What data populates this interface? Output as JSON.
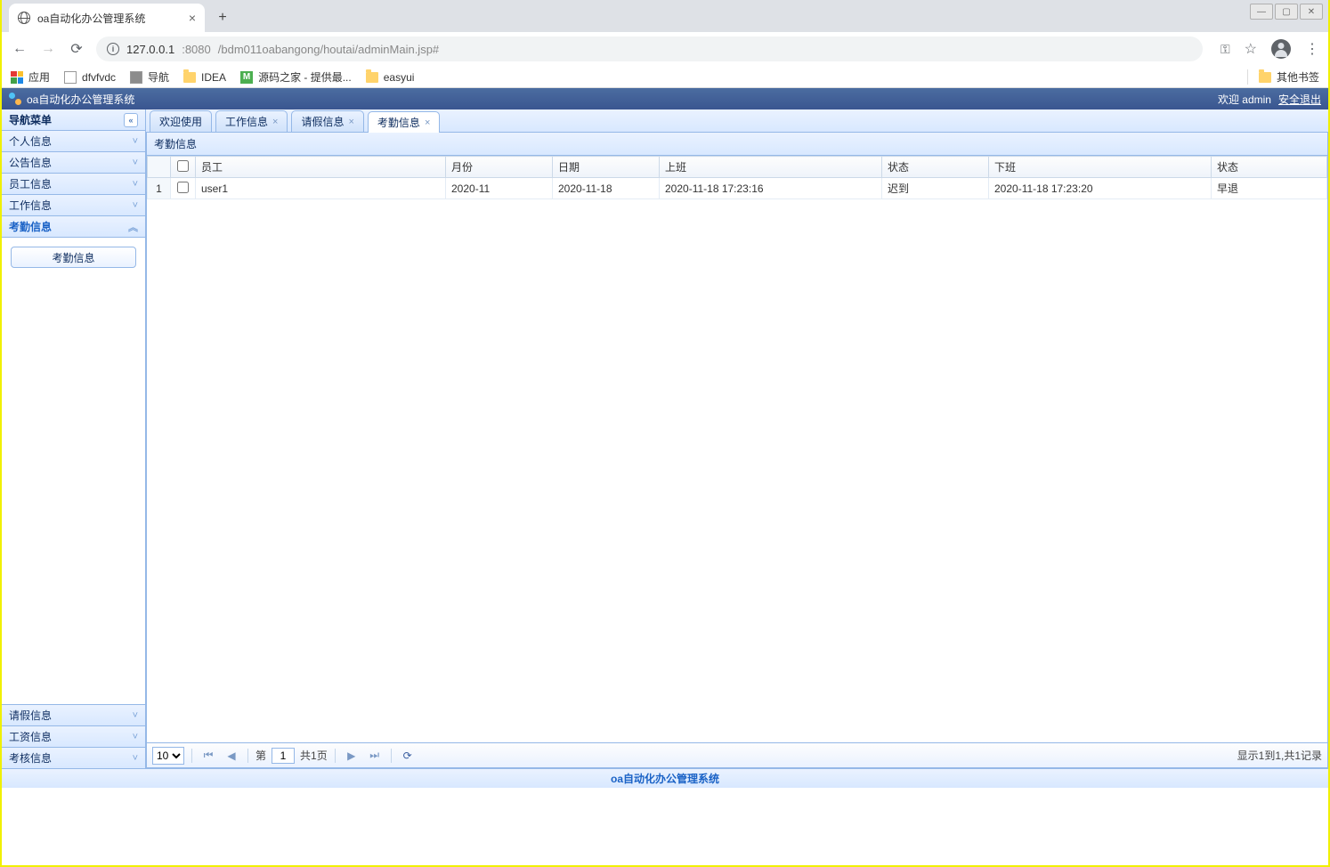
{
  "browser": {
    "tab_title": "oa自动化办公管理系统",
    "url_host": "127.0.0.1",
    "url_port": ":8080",
    "url_path": "/bdm011oabangong/houtai/adminMain.jsp#",
    "bookmarks": {
      "apps": "应用",
      "items": [
        "dfvfvdc",
        "导航",
        "IDEA",
        "源码之家 - 提供最...",
        "easyui"
      ],
      "other": "其他书签"
    }
  },
  "header": {
    "title": "oa自动化办公管理系统",
    "welcome": "欢迎 admin",
    "logout": "安全退出"
  },
  "sidebar": {
    "title": "导航菜单",
    "top": [
      "个人信息",
      "公告信息",
      "员工信息",
      "工作信息",
      "考勤信息"
    ],
    "active_index": 4,
    "body_button": "考勤信息",
    "bottom": [
      "请假信息",
      "工资信息",
      "考核信息"
    ]
  },
  "tabs": [
    {
      "label": "欢迎使用",
      "closable": false,
      "active": false
    },
    {
      "label": "工作信息",
      "closable": true,
      "active": false
    },
    {
      "label": "请假信息",
      "closable": true,
      "active": false
    },
    {
      "label": "考勤信息",
      "closable": true,
      "active": true
    }
  ],
  "panel": {
    "title": "考勤信息",
    "columns": [
      "员工",
      "月份",
      "日期",
      "上班",
      "状态",
      "下班",
      "状态"
    ],
    "rows": [
      {
        "num": "1",
        "cells": [
          "user1",
          "2020-11",
          "2020-11-18",
          "2020-11-18 17:23:16",
          "迟到",
          "2020-11-18 17:23:20",
          "早退"
        ]
      }
    ]
  },
  "pager": {
    "page_size": "10",
    "page_label_pre": "第",
    "page_value": "1",
    "page_label_post": "共1页",
    "info": "显示1到1,共1记录"
  },
  "footer": "oa自动化办公管理系统"
}
